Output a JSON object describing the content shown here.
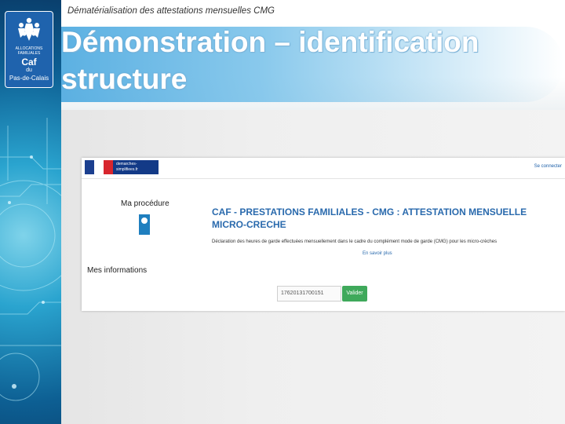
{
  "slide": {
    "subtitle": "Dématérialisation des attestations mensuelles CMG",
    "title": "Démonstration – identification structure"
  },
  "logo": {
    "line1": "ALLOCATIONS FAMILIALES",
    "caf": "Caf",
    "du": "du",
    "dept": "Pas-de-Calais"
  },
  "screenshot": {
    "header": {
      "badge": "demarches-simplifiees.fr",
      "link": "Se connecter"
    },
    "sidebar_heading": "Ma procédure",
    "procedure_title": "CAF - PRESTATIONS FAMILIALES - CMG : ATTESTATION MENSUELLE MICRO-CRECHE",
    "procedure_description": "Déclaration des heures de garde effectuées mensuellement dans le cadre du complément mode de garde (CMG) pour les micro-crèches",
    "learn_more": "En savoir plus",
    "section_heading": "Mes informations",
    "siret_value": "17620131700151",
    "validate_label": "Valider"
  },
  "colors": {
    "title_text": "#ffffff",
    "procedure_blue": "#2a6aad",
    "validate_green": "#3fa95b",
    "caf_blue": "#1f63ad"
  }
}
